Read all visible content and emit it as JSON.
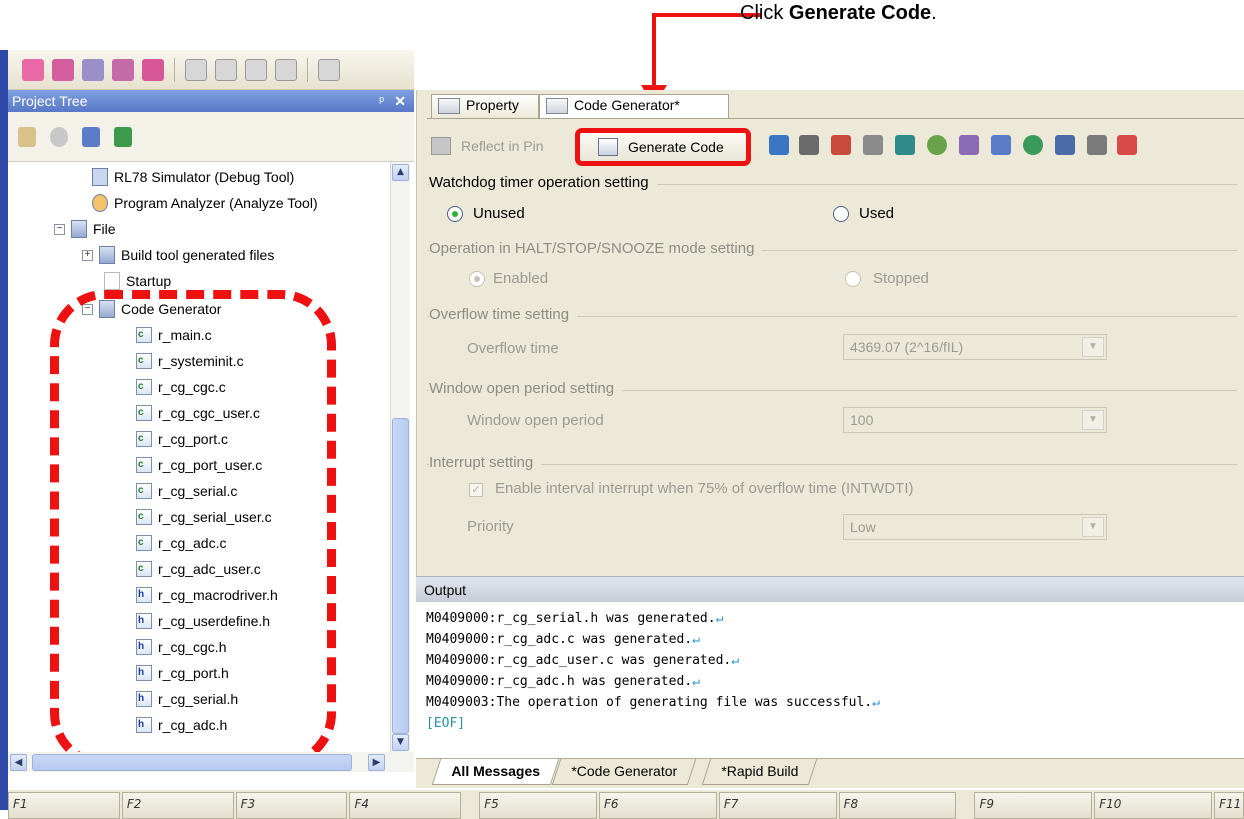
{
  "callout": {
    "prefix": "Click ",
    "bold": "Generate Code",
    "suffix": "."
  },
  "project_tree": {
    "title": "Project Tree",
    "pin": "ᵖ",
    "close": "✕",
    "items": [
      {
        "label": "RL78 Simulator (Debug Tool)"
      },
      {
        "label": "Program Analyzer (Analyze Tool)"
      },
      {
        "label": "File"
      },
      {
        "label": "Build tool generated files"
      },
      {
        "label": "Startup"
      },
      {
        "label": "Code Generator"
      }
    ],
    "files": [
      "r_main.c",
      "r_systeminit.c",
      "r_cg_cgc.c",
      "r_cg_cgc_user.c",
      "r_cg_port.c",
      "r_cg_port_user.c",
      "r_cg_serial.c",
      "r_cg_serial_user.c",
      "r_cg_adc.c",
      "r_cg_adc_user.c",
      "r_cg_macrodriver.h",
      "r_cg_userdefine.h",
      "r_cg_cgc.h",
      "r_cg_port.h",
      "r_cg_serial.h",
      "r_cg_adc.h"
    ]
  },
  "tabs": {
    "property": "Property",
    "code_generator": "Code Generator*"
  },
  "toolbar": {
    "reflect": "Reflect in Pin",
    "generate": "Generate Code"
  },
  "settings": {
    "watchdog_title": "Watchdog timer operation setting",
    "unused": "Unused",
    "used": "Used",
    "halt_title": "Operation in HALT/STOP/SNOOZE mode setting",
    "enabled": "Enabled",
    "stopped": "Stopped",
    "overflow_title": "Overflow time setting",
    "overflow_label": "Overflow time",
    "overflow_value": "4369.07 (2^16/fIL)",
    "window_title": "Window open period setting",
    "window_label": "Window open period",
    "window_value": "100",
    "interrupt_title": "Interrupt setting",
    "interrupt_check": "Enable interval interrupt when 75% of overflow time (INTWDTI)",
    "priority_label": "Priority",
    "priority_value": "Low"
  },
  "output": {
    "title": "Output",
    "lines": [
      "M0409000:r_cg_serial.h was generated.",
      "M0409000:r_cg_adc.c was generated.",
      "M0409000:r_cg_adc_user.c was generated.",
      "M0409000:r_cg_adc.h was generated.",
      "M0409003:The operation of generating file was successful."
    ],
    "return_glyph": "↵",
    "eof": "[EOF]",
    "tabs": [
      "All Messages",
      "*Code Generator",
      "*Rapid Build"
    ]
  },
  "fkeys": [
    "F1",
    "F2",
    "F3",
    "F4",
    "F5",
    "F6",
    "F7",
    "F8",
    "F9",
    "F10",
    "F11"
  ],
  "colors": {
    "accent_red": "#ee1111",
    "panel": "#ece9d8",
    "title_blue": "#5878c8"
  }
}
